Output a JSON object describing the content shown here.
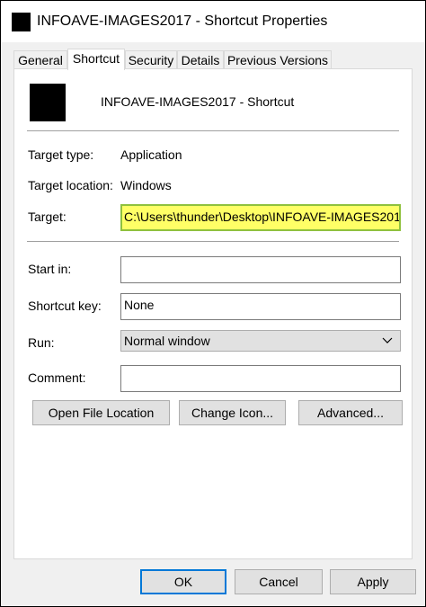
{
  "window": {
    "title": "INFOAVE-IMAGES2017 - Shortcut Properties"
  },
  "tabs": [
    {
      "label": "General",
      "active": false
    },
    {
      "label": "Shortcut",
      "active": true
    },
    {
      "label": "Security",
      "active": false
    },
    {
      "label": "Details",
      "active": false
    },
    {
      "label": "Previous Versions",
      "active": false
    }
  ],
  "header": {
    "shortcut_name": "INFOAVE-IMAGES2017 - Shortcut"
  },
  "info": {
    "target_type_label": "Target type:",
    "target_type_value": "Application",
    "target_location_label": "Target location:",
    "target_location_value": "Windows",
    "target_label": "Target:",
    "target_value": "C:\\Users\\thunder\\Desktop\\INFOAVE-IMAGES201"
  },
  "fields": {
    "start_in_label": "Start in:",
    "start_in_value": "",
    "shortcut_key_label": "Shortcut key:",
    "shortcut_key_value": "None",
    "run_label": "Run:",
    "run_value": "Normal window",
    "comment_label": "Comment:",
    "comment_value": ""
  },
  "actions": {
    "open_file_location": "Open File Location",
    "change_icon": "Change Icon...",
    "advanced": "Advanced..."
  },
  "footer": {
    "ok": "OK",
    "cancel": "Cancel",
    "apply": "Apply"
  },
  "colors": {
    "target_highlight": "#ffff66",
    "target_highlight_border": "#8fc13e",
    "default_button_border": "#0078d7"
  }
}
